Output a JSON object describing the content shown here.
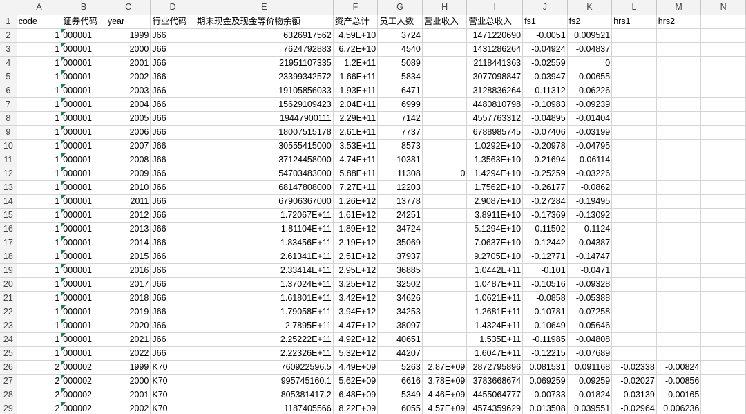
{
  "columns": [
    "A",
    "B",
    "C",
    "D",
    "E",
    "F",
    "G",
    "H",
    "I",
    "J",
    "K",
    "L",
    "M",
    "N"
  ],
  "header_row": {
    "row_num": "1",
    "cells": [
      "code",
      "证券代码",
      "year",
      "行业代码",
      "期末现金及现金等价物余额",
      "资产总计",
      "员工人数",
      "营业收入",
      "营业总收入",
      "fs1",
      "fs2",
      "hrs1",
      "hrs2",
      ""
    ]
  },
  "rows": [
    {
      "n": "2",
      "c": [
        "1",
        "000001",
        "1999",
        "J66",
        "6326917562",
        "4.59E+10",
        "3724",
        "",
        "1471220690",
        "-0.0051",
        "0.009521",
        "",
        ""
      ]
    },
    {
      "n": "3",
      "c": [
        "1",
        "000001",
        "2000",
        "J66",
        "7624792883",
        "6.72E+10",
        "4540",
        "",
        "1431286264",
        "-0.04924",
        "-0.04837",
        "",
        ""
      ]
    },
    {
      "n": "4",
      "c": [
        "1",
        "000001",
        "2001",
        "J66",
        "21951107335",
        "1.2E+11",
        "5089",
        "",
        "2118441363",
        "-0.02559",
        "0",
        "",
        ""
      ]
    },
    {
      "n": "5",
      "c": [
        "1",
        "000001",
        "2002",
        "J66",
        "23399342572",
        "1.66E+11",
        "5834",
        "",
        "3077098847",
        "-0.03947",
        "-0.00655",
        "",
        ""
      ]
    },
    {
      "n": "6",
      "c": [
        "1",
        "000001",
        "2003",
        "J66",
        "19105856033",
        "1.93E+11",
        "6471",
        "",
        "3128836264",
        "-0.11312",
        "-0.06226",
        "",
        ""
      ]
    },
    {
      "n": "7",
      "c": [
        "1",
        "000001",
        "2004",
        "J66",
        "15629109423",
        "2.04E+11",
        "6999",
        "",
        "4480810798",
        "-0.10983",
        "-0.09239",
        "",
        ""
      ]
    },
    {
      "n": "8",
      "c": [
        "1",
        "000001",
        "2005",
        "J66",
        "19447900111",
        "2.29E+11",
        "7142",
        "",
        "4557763312",
        "-0.04895",
        "-0.01404",
        "",
        ""
      ]
    },
    {
      "n": "9",
      "c": [
        "1",
        "000001",
        "2006",
        "J66",
        "18007515178",
        "2.61E+11",
        "7737",
        "",
        "6788985745",
        "-0.07406",
        "-0.03199",
        "",
        ""
      ]
    },
    {
      "n": "10",
      "c": [
        "1",
        "000001",
        "2007",
        "J66",
        "30555415000",
        "3.53E+11",
        "8573",
        "",
        "1.0292E+10",
        "-0.20978",
        "-0.04795",
        "",
        ""
      ]
    },
    {
      "n": "11",
      "c": [
        "1",
        "000001",
        "2008",
        "J66",
        "37124458000",
        "4.74E+11",
        "10381",
        "",
        "1.3563E+10",
        "-0.21694",
        "-0.06114",
        "",
        ""
      ]
    },
    {
      "n": "12",
      "c": [
        "1",
        "000001",
        "2009",
        "J66",
        "54703483000",
        "5.88E+11",
        "11308",
        "0",
        "1.4294E+10",
        "-0.25259",
        "-0.03226",
        "",
        ""
      ]
    },
    {
      "n": "13",
      "c": [
        "1",
        "000001",
        "2010",
        "J66",
        "68147808000",
        "7.27E+11",
        "12203",
        "",
        "1.7562E+10",
        "-0.26177",
        "-0.0862",
        "",
        ""
      ]
    },
    {
      "n": "14",
      "c": [
        "1",
        "000001",
        "2011",
        "J66",
        "67906367000",
        "1.26E+12",
        "13778",
        "",
        "2.9087E+10",
        "-0.27284",
        "-0.19495",
        "",
        ""
      ]
    },
    {
      "n": "15",
      "c": [
        "1",
        "000001",
        "2012",
        "J66",
        "1.72067E+11",
        "1.61E+12",
        "24251",
        "",
        "3.8911E+10",
        "-0.17369",
        "-0.13092",
        "",
        ""
      ]
    },
    {
      "n": "16",
      "c": [
        "1",
        "000001",
        "2013",
        "J66",
        "1.81104E+11",
        "1.89E+12",
        "34724",
        "",
        "5.1294E+10",
        "-0.11502",
        "-0.1124",
        "",
        ""
      ]
    },
    {
      "n": "17",
      "c": [
        "1",
        "000001",
        "2014",
        "J66",
        "1.83456E+11",
        "2.19E+12",
        "35069",
        "",
        "7.0637E+10",
        "-0.12442",
        "-0.04387",
        "",
        ""
      ]
    },
    {
      "n": "18",
      "c": [
        "1",
        "000001",
        "2015",
        "J66",
        "2.61341E+11",
        "2.51E+12",
        "37937",
        "",
        "9.2705E+10",
        "-0.12771",
        "-0.14747",
        "",
        ""
      ]
    },
    {
      "n": "19",
      "c": [
        "1",
        "000001",
        "2016",
        "J66",
        "2.33414E+11",
        "2.95E+12",
        "36885",
        "",
        "1.0442E+11",
        "-0.101",
        "-0.0471",
        "",
        ""
      ]
    },
    {
      "n": "20",
      "c": [
        "1",
        "000001",
        "2017",
        "J66",
        "1.37024E+11",
        "3.25E+12",
        "32502",
        "",
        "1.0487E+11",
        "-0.10516",
        "-0.09328",
        "",
        ""
      ]
    },
    {
      "n": "21",
      "c": [
        "1",
        "000001",
        "2018",
        "J66",
        "1.61801E+11",
        "3.42E+12",
        "34626",
        "",
        "1.0621E+11",
        "-0.0858",
        "-0.05388",
        "",
        ""
      ]
    },
    {
      "n": "22",
      "c": [
        "1",
        "000001",
        "2019",
        "J66",
        "1.79058E+11",
        "3.94E+12",
        "34253",
        "",
        "1.2681E+11",
        "-0.10781",
        "-0.07258",
        "",
        ""
      ]
    },
    {
      "n": "23",
      "c": [
        "1",
        "000001",
        "2020",
        "J66",
        "2.7895E+11",
        "4.47E+12",
        "38097",
        "",
        "1.4324E+11",
        "-0.10649",
        "-0.05646",
        "",
        ""
      ]
    },
    {
      "n": "24",
      "c": [
        "1",
        "000001",
        "2021",
        "J66",
        "2.25222E+11",
        "4.92E+12",
        "40651",
        "",
        "1.535E+11",
        "-0.11985",
        "-0.04808",
        "",
        ""
      ]
    },
    {
      "n": "25",
      "c": [
        "1",
        "000001",
        "2022",
        "J66",
        "2.22326E+11",
        "5.32E+12",
        "44207",
        "",
        "1.6047E+11",
        "-0.12215",
        "-0.07689",
        "",
        ""
      ]
    },
    {
      "n": "26",
      "c": [
        "2",
        "000002",
        "1999",
        "K70",
        "760922596.5",
        "4.49E+09",
        "5263",
        "2.87E+09",
        "2872795896",
        "0.081531",
        "0.091168",
        "-0.02338",
        "-0.00824"
      ]
    },
    {
      "n": "27",
      "c": [
        "2",
        "000002",
        "2000",
        "K70",
        "995745160.1",
        "5.62E+09",
        "6616",
        "3.78E+09",
        "3783668674",
        "0.069259",
        "0.09259",
        "-0.02027",
        "-0.00856"
      ]
    },
    {
      "n": "28",
      "c": [
        "2",
        "000002",
        "2001",
        "K70",
        "805381417.2",
        "6.48E+09",
        "5349",
        "4.46E+09",
        "4455064777",
        "-0.00733",
        "0.01824",
        "-0.03139",
        "-0.00165"
      ]
    },
    {
      "n": "29",
      "c": [
        "2",
        "000002",
        "2002",
        "K70",
        "1187405566",
        "8.22E+09",
        "6055",
        "4.57E+09",
        "4574359629",
        "0.013508",
        "0.039551",
        "-0.02964",
        "0.006236"
      ]
    }
  ]
}
